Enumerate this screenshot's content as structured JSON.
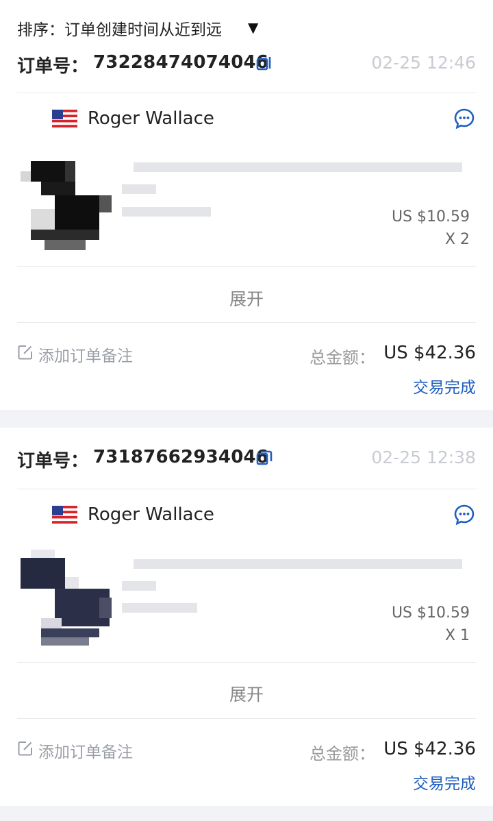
{
  "sort": {
    "label": "排序：订单创建时间从近到远",
    "icon": "caret-down-icon"
  },
  "orders": [
    {
      "order_no_label": "订单号：",
      "order_no": "73228474074046",
      "time": "02-25 12:46",
      "buyer": "Roger Wallace",
      "price": "US $10.59",
      "qty": "X 2",
      "expand": "展开",
      "note_label": "添加订单备注",
      "total_label": "总金额：",
      "total_value": "US $42.36",
      "status": "交易完成"
    },
    {
      "order_no_label": "订单号：",
      "order_no": "73187662934046",
      "time": "02-25 12:38",
      "buyer": "Roger Wallace",
      "price": "US $10.59",
      "qty": "X 1",
      "expand": "展开",
      "note_label": "添加订单备注",
      "total_label": "总金额：",
      "total_value": "US $42.36",
      "status": "交易完成"
    }
  ],
  "colors": {
    "accent": "#1f5fbf",
    "muted": "#c8cbd2",
    "bg": "#f2f3f7"
  }
}
